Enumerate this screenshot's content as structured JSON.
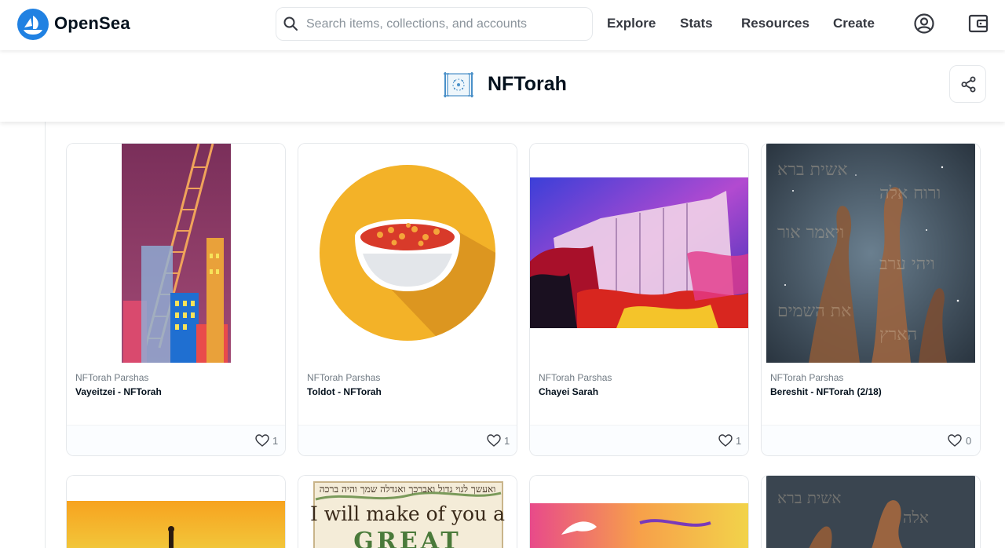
{
  "nav": {
    "brand": "OpenSea",
    "search_placeholder": "Search items, collections, and accounts",
    "links": [
      "Explore",
      "Stats",
      "Resources",
      "Create"
    ]
  },
  "collection": {
    "title": "NFTorah"
  },
  "cards": [
    {
      "collection": "NFTorah Parshas",
      "name": "Vayeitzei - NFTorah",
      "favorites": "1"
    },
    {
      "collection": "NFTorah Parshas",
      "name": "Toldot - NFTorah",
      "favorites": "1"
    },
    {
      "collection": "NFTorah Parshas",
      "name": "Chayei Sarah",
      "favorites": "1"
    },
    {
      "collection": "NFTorah Parshas",
      "name": "Bereshit - NFTorah (2/18)",
      "favorites": "0"
    }
  ],
  "row2_cards": [
    {
      "image_text_hebrew": "ואעשך לגוי גדול ואברכך ואגדלה שמך והיה ברכה",
      "image_text": "I will make of you a",
      "image_text_2": "GREAT"
    }
  ],
  "colors": {
    "accent": "#2081e2",
    "text": "#04111d",
    "muted": "#707a83",
    "border": "#e5e8eb"
  }
}
